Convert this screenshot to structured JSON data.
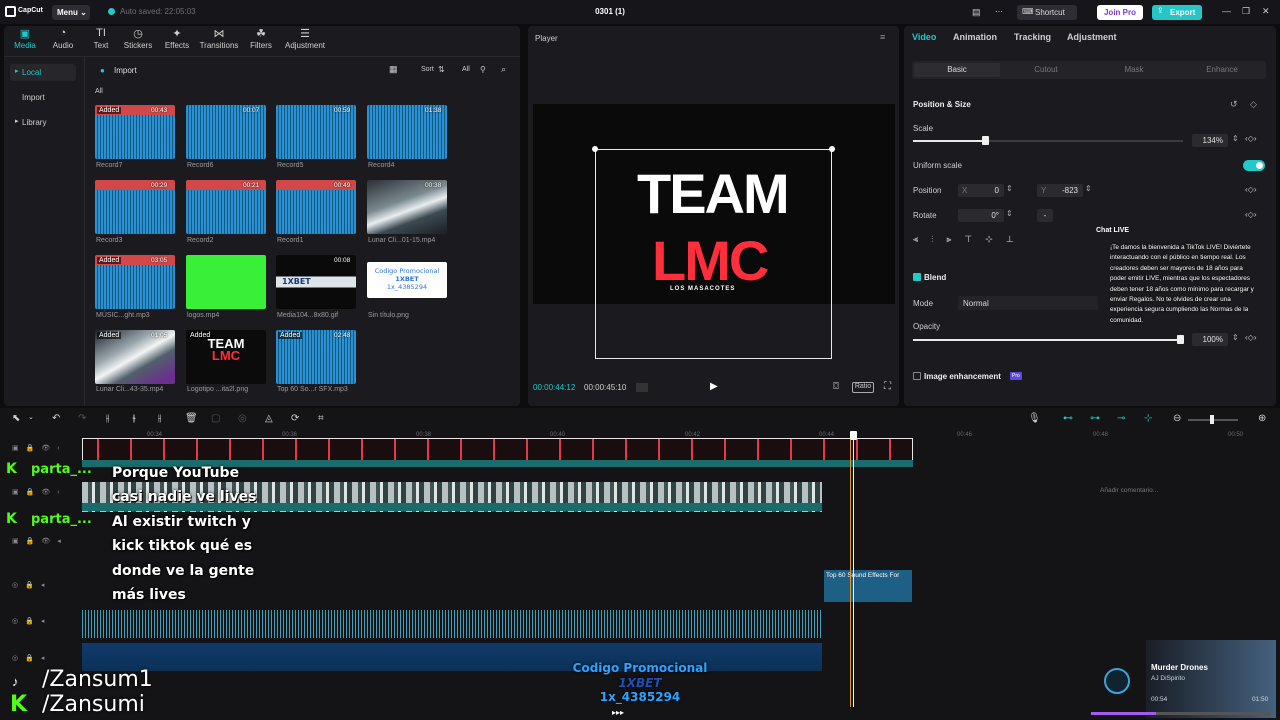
{
  "titlebar": {
    "logo": "CapCut",
    "menu": "Menu",
    "autosave": "Auto saved: 22:05:03",
    "project_title": "0301 (1)",
    "shortcut": "Shortcut",
    "join_pro": "Join Pro",
    "export": "Export"
  },
  "toolbar": {
    "tabs": [
      {
        "label": "Media",
        "icon": "media-icon"
      },
      {
        "label": "Audio",
        "icon": "audio-icon"
      },
      {
        "label": "Text",
        "icon": "text-icon"
      },
      {
        "label": "Stickers",
        "icon": "stickers-icon"
      },
      {
        "label": "Effects",
        "icon": "effects-icon"
      },
      {
        "label": "Transitions",
        "icon": "transitions-icon"
      },
      {
        "label": "Filters",
        "icon": "filters-icon"
      },
      {
        "label": "Adjustment",
        "icon": "adjustment-icon"
      }
    ]
  },
  "media": {
    "side": {
      "local": "Local",
      "import": "Import",
      "library": "Library"
    },
    "import_btn": "Import",
    "sort": "Sort",
    "all_filter": "All",
    "section": "All",
    "items": [
      {
        "name": "Record7",
        "dur": "00:43",
        "added": "Added"
      },
      {
        "name": "Record6",
        "dur": "00:07",
        "added": ""
      },
      {
        "name": "Record5",
        "dur": "00:59",
        "added": ""
      },
      {
        "name": "Record4",
        "dur": "01:38",
        "added": ""
      },
      {
        "name": "Record3",
        "dur": "00:29",
        "added": ""
      },
      {
        "name": "Record2",
        "dur": "00:21",
        "added": ""
      },
      {
        "name": "Record1",
        "dur": "00:49",
        "added": ""
      },
      {
        "name": "Lunar Cli...01-15.mp4",
        "dur": "00:38",
        "added": ""
      },
      {
        "name": "MÚSIC...ght.mp3",
        "dur": "03:05",
        "added": "Added"
      },
      {
        "name": "logos.mp4",
        "dur": "",
        "added": ""
      },
      {
        "name": "Media104...8x80.gif",
        "dur": "00:08",
        "added": ""
      },
      {
        "name": "Sin título.png",
        "dur": "",
        "added": ""
      },
      {
        "name": "Lunar Cli...43-35.mp4",
        "dur": "01:05",
        "added": "Added"
      },
      {
        "name": "Logotipo ...ita2l.png",
        "dur": "",
        "added": "Added"
      },
      {
        "name": "Top 60 So...r SFX.mp3",
        "dur": "02:48",
        "added": "Added"
      }
    ],
    "promo_thumb": {
      "l1": "Codigo Promocional",
      "l2": "1XBET",
      "l3": "1x_4385294"
    },
    "team_thumb": {
      "l1": "TEAM",
      "l2": "LMC"
    },
    "gif_thumb": "1XBET"
  },
  "player": {
    "title": "Player",
    "team": "TEAM",
    "lmc": "LMC",
    "subtitle": "LOS MASACOTES",
    "current_time": "00:00:44:12",
    "total_time": "00:00:45:10",
    "ratio": "Ratio"
  },
  "props": {
    "tabs": [
      "Video",
      "Animation",
      "Tracking",
      "Adjustment"
    ],
    "subtabs": [
      "Basic",
      "Cutout",
      "Mask",
      "Enhance"
    ],
    "section_title": "Position & Size",
    "scale_label": "Scale",
    "scale_value": "134%",
    "scale_level": 0.18,
    "uniform_label": "Uniform scale",
    "position_label": "Position",
    "x_label": "X",
    "x_value": "0",
    "y_label": "Y",
    "y_value": "-823",
    "rotate_label": "Rotate",
    "rotate_value": "0°",
    "rotate_dash": "-",
    "blend_label": "Blend",
    "mode_label": "Mode",
    "mode_value": "Normal",
    "opacity_label": "Opacity",
    "opacity_value": "100%",
    "opacity_level": 1.0,
    "enhance_label": "Image enhancement",
    "enhance_badge": "Pro"
  },
  "chat": {
    "title": "Chat LIVE",
    "lines": [
      "¡Te damos la bienvenida a TikTok LIVE! Diviértete",
      "interactuando con el público en tiempo real. Los",
      "creadores deben ser mayores de 18 años para",
      "poder emitir LIVE, mientras que los espectadores",
      "deben tener 18 años como mínimo para recargar y",
      "enviar Regalos. No te olvides de crear una",
      "experiencia segura cumpliendo las Normas de la",
      "comunidad."
    ]
  },
  "timeline": {
    "ticks": [
      "00:34",
      "00:36",
      "00:38",
      "00:40",
      "00:42",
      "00:44",
      "00:46",
      "00:48",
      "00:50"
    ],
    "sfx_clip": "Top 60 Sound Effects For",
    "comment": "Añadir comentario..."
  },
  "overlay": {
    "parta1": "parta_...",
    "parta2": "parta_...",
    "k1": "K",
    "k2": "K",
    "caption_lines": [
      "Porque YouTube",
      "casi nadie ve lives",
      "Al existir twitch y",
      "kick tiktok qué es",
      "donde ve la gente",
      "más lives"
    ],
    "social1": "/Zansum1",
    "social2": "/Zansumi",
    "promo1": "Codigo Promocional",
    "promo2": "1XBET",
    "promo3": "1x_4385294"
  },
  "music": {
    "title": "Murder Drones",
    "artist": "AJ DiSpirito",
    "elapsed": "00:54",
    "total": "01:50",
    "progress": 0.36
  }
}
